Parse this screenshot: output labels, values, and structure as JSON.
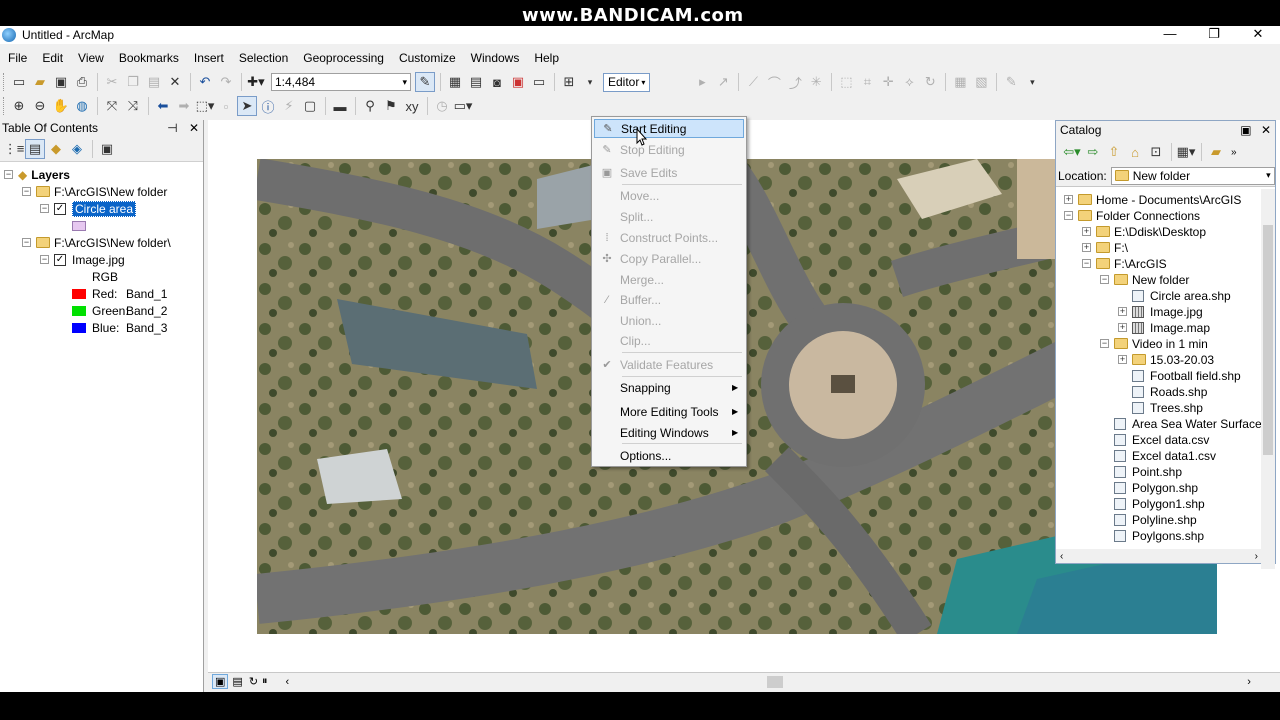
{
  "window": {
    "title": "Untitled - ArcMap",
    "minimize": "—",
    "restore": "❐",
    "close": "✕"
  },
  "watermark": "www.BANDICAM.com",
  "menubar": [
    "File",
    "Edit",
    "View",
    "Bookmarks",
    "Insert",
    "Selection",
    "Geoprocessing",
    "Customize",
    "Windows",
    "Help"
  ],
  "toolbar": {
    "scale": "1:4,484",
    "editor_label": "Editor"
  },
  "toc": {
    "title": "Table Of Contents",
    "layers_label": "Layers",
    "group1_path": "F:\\ArcGIS\\New folder",
    "layer1_name": "Circle area",
    "group2_path": "F:\\ArcGIS\\New folder\\",
    "layer2_name": "Image.jpg",
    "rgb_label": "RGB",
    "bands": [
      {
        "label": "Red:",
        "band": "Band_1",
        "color": "#ff0000"
      },
      {
        "label": "Green:",
        "band": "Band_2",
        "color": "#00e000"
      },
      {
        "label": "Blue:",
        "band": "Band_3",
        "color": "#0000ff"
      }
    ],
    "circle_swatch_color": "#e6c8f0"
  },
  "editor_menu": {
    "items": [
      {
        "label": "Start Editing",
        "enabled": true,
        "highlighted": true,
        "icon": "pencil-icon"
      },
      {
        "label": "Stop Editing",
        "enabled": false
      },
      {
        "label": "Save Edits",
        "enabled": false
      },
      {
        "label": "Move...",
        "enabled": false
      },
      {
        "label": "Split...",
        "enabled": false
      },
      {
        "label": "Construct Points...",
        "enabled": false
      },
      {
        "label": "Copy Parallel...",
        "enabled": false
      },
      {
        "label": "Merge...",
        "enabled": false
      },
      {
        "label": "Buffer...",
        "enabled": false
      },
      {
        "label": "Union...",
        "enabled": false
      },
      {
        "label": "Clip...",
        "enabled": false
      },
      {
        "label": "Validate Features",
        "enabled": false
      },
      {
        "label": "Snapping",
        "enabled": true,
        "submenu": true
      },
      {
        "label": "More Editing Tools",
        "enabled": true,
        "submenu": true
      },
      {
        "label": "Editing Windows",
        "enabled": true,
        "submenu": true
      },
      {
        "label": "Options...",
        "enabled": true
      }
    ]
  },
  "catalog": {
    "title": "Catalog",
    "location_label": "Location:",
    "location_value": "New folder",
    "tree": [
      "Home - Documents\\ArcGIS",
      "Folder Connections",
      "E:\\Ddisk\\Desktop",
      "F:\\",
      "F:\\ArcGIS",
      "New folder",
      "Circle area.shp",
      "Image.jpg",
      "Image.map",
      "Video in 1 min",
      "15.03-20.03",
      "Football field.shp",
      "Roads.shp",
      "Trees.shp",
      "Area Sea Water Surface.s",
      "Excel data.csv",
      "Excel data1.csv",
      "Point.shp",
      "Polygon.shp",
      "Polygon1.shp",
      "Polyline.shp",
      "Poylgons.shp"
    ]
  }
}
